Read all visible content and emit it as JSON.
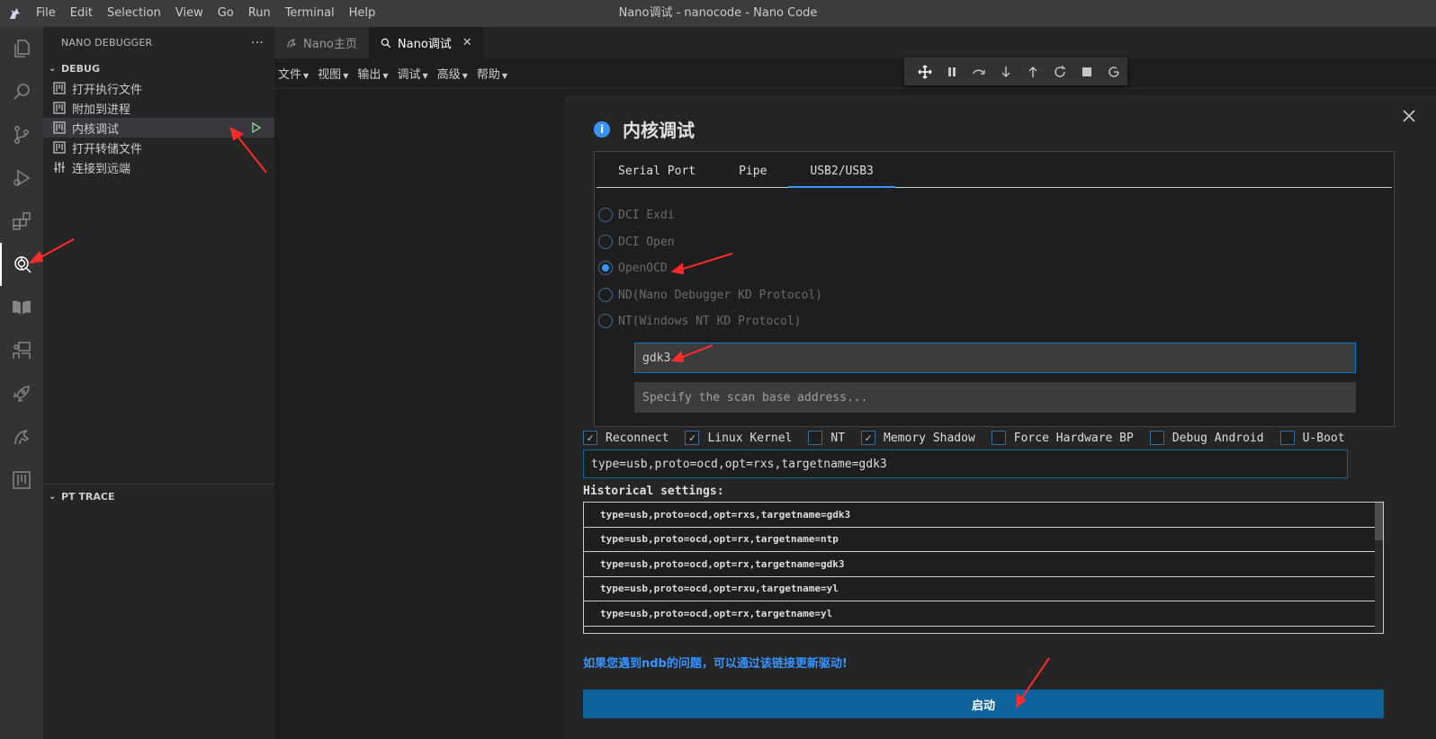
{
  "window": {
    "title": "Nano调试 - nanocode - Nano Code"
  },
  "menubar": [
    "File",
    "Edit",
    "Selection",
    "View",
    "Go",
    "Run",
    "Terminal",
    "Help"
  ],
  "activity_icons": [
    "explorer-icon",
    "search-icon",
    "source-control-icon",
    "run-debug-icon",
    "extensions-icon",
    "nano-debugger-icon",
    "book-icon",
    "remote-icon",
    "rocket-icon",
    "horse-icon",
    "board-icon"
  ],
  "sidebar": {
    "title": "NANO DEBUGGER",
    "more": "···",
    "debug_section": "DEBUG",
    "items": [
      {
        "label": "打开执行文件",
        "icon": "board-icon"
      },
      {
        "label": "附加到进程",
        "icon": "board-icon"
      },
      {
        "label": "内核调试",
        "icon": "board-icon"
      },
      {
        "label": "打开转储文件",
        "icon": "board-icon"
      },
      {
        "label": "连接到远端",
        "icon": "sliders-icon"
      }
    ],
    "pt_section": "PT TRACE"
  },
  "tabs": [
    {
      "label": "Nano主页",
      "icon": "horse-icon"
    },
    {
      "label": "Nano调试",
      "icon": "bug-search-icon",
      "close": "✕"
    }
  ],
  "editor_menu": [
    "文件",
    "视图",
    "输出",
    "调试",
    "高级",
    "帮助"
  ],
  "debug_toolbar": [
    "move-icon",
    "pause-icon",
    "step-over-icon",
    "step-into-icon",
    "step-out-icon",
    "restart-icon",
    "stop-icon",
    "disconnect-icon"
  ],
  "dialog": {
    "title": "内核调试",
    "close": "✕",
    "protocol_tabs": [
      "Serial Port",
      "Pipe",
      "USB2/USB3"
    ],
    "active_protocol_tab": "USB2/USB3",
    "radios": [
      {
        "label": "DCI Exdi",
        "checked": false
      },
      {
        "label": "DCI Open",
        "checked": false
      },
      {
        "label": "OpenOCD",
        "checked": true
      },
      {
        "label": "ND(Nano Debugger KD Protocol)",
        "checked": false
      },
      {
        "label": "NT(Windows NT KD Protocol)",
        "checked": false
      }
    ],
    "target_name_value": "gdk3",
    "scan_base_placeholder": "Specify the scan base address...",
    "options": [
      {
        "label": "Reconnect",
        "checked": true
      },
      {
        "label": "Linux Kernel",
        "checked": true
      },
      {
        "label": "NT",
        "checked": false
      },
      {
        "label": "Memory Shadow",
        "checked": true
      },
      {
        "label": "Force Hardware BP",
        "checked": false
      },
      {
        "label": "Debug Android",
        "checked": false
      },
      {
        "label": "U-Boot",
        "checked": false
      }
    ],
    "command_line": "type=usb,proto=ocd,opt=rxs,targetname=gdk3",
    "history_label": "Historical settings:",
    "history": [
      "type=usb,proto=ocd,opt=rxs,targetname=gdk3",
      "type=usb,proto=ocd,opt=rx,targetname=ntp",
      "type=usb,proto=ocd,opt=rx,targetname=gdk3",
      "type=usb,proto=ocd,opt=rxu,targetname=yl",
      "type=usb,proto=ocd,opt=rx,targetname=yl"
    ],
    "help_link": "如果您遇到ndb的问题，可以通过该链接更新驱动!",
    "start_button": "启动"
  },
  "colors": {
    "accent": "#3794ff",
    "button": "#0e639c",
    "annotation_arrow": "#ff2a2a",
    "run_icon": "#89d185"
  }
}
